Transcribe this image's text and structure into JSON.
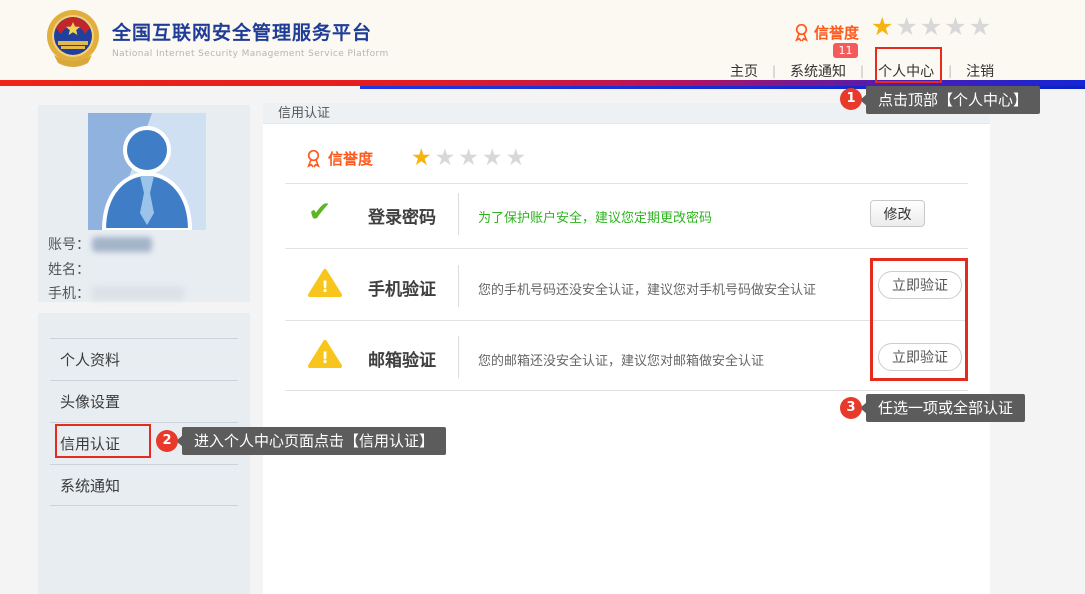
{
  "header": {
    "title": "全国互联网安全管理服务平台",
    "subtitle": "National Internet Security Management Service Platform",
    "reputation_label": "信誉度",
    "notification_badge": "11",
    "nav_separator": "|",
    "nav": [
      {
        "label": "主页"
      },
      {
        "label": "系统通知"
      },
      {
        "label": "个人中心"
      },
      {
        "label": "注销"
      }
    ]
  },
  "rating": {
    "filled": 1,
    "total": 5
  },
  "sidebar": {
    "profile": {
      "account_label": "账号：",
      "name_label": "姓名：",
      "phone_label": "手机："
    },
    "menu": [
      {
        "label": "个人资料"
      },
      {
        "label": "头像设置"
      },
      {
        "label": "信用认证",
        "highlighted": true
      },
      {
        "label": "系统通知"
      }
    ]
  },
  "main": {
    "panel_title": "信用认证",
    "reputation_label": "信誉度",
    "rows": [
      {
        "icon": "check",
        "title": "登录密码",
        "desc": "为了保护账户安全，建议您定期更改密码",
        "button": "修改"
      },
      {
        "icon": "warning",
        "title": "手机验证",
        "desc": "您的手机号码还没安全认证，建议您对手机号码做安全认证",
        "button": "立即验证"
      },
      {
        "icon": "warning",
        "title": "邮箱验证",
        "desc": "您的邮箱还没安全认证，建议您对邮箱做安全认证",
        "button": "立即验证"
      }
    ]
  },
  "annotations": {
    "steps": [
      {
        "num": "1",
        "text": "点击顶部【个人中心】"
      },
      {
        "num": "2",
        "text": "进入个人中心页面点击【信用认证】"
      },
      {
        "num": "3",
        "text": "任选一项或全部认证"
      }
    ]
  },
  "icons": {
    "star": "★",
    "check": "✔",
    "warning_mark": "!"
  },
  "colors": {
    "accent_red": "#e52b1e",
    "orange": "#ff5a1e",
    "star_gold": "#f6b40e",
    "star_empty": "#d8d8d8",
    "green": "#2db31e",
    "warning_yellow": "#f7c51c",
    "bar_blue": "#1226d8",
    "title_blue": "#1f3d96"
  }
}
